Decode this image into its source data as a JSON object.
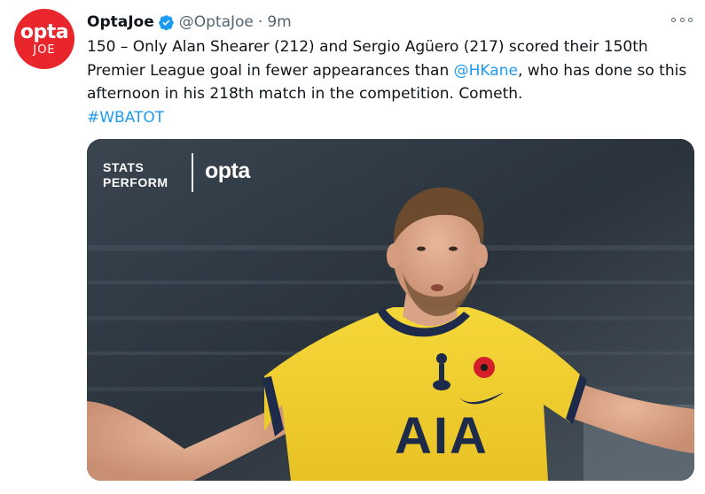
{
  "author": {
    "avatar_line1": "opta",
    "avatar_line2": "JOE",
    "name": "OptaJoe",
    "handle": "@OptaJoe",
    "separator": "·",
    "time": "9m"
  },
  "tweet": {
    "text_part1": "150 – Only Alan Shearer (212) and Sergio Agüero (217) scored their 150th Premier League goal in fewer appearances than ",
    "mention": "@HKane",
    "text_part2": ", who has done so this afternoon in his 218th match in the competition. Cometh.",
    "hashtag": "#WBATOT"
  },
  "media": {
    "logo_stats": "STATS",
    "logo_perform": "PERFORM",
    "logo_opta": "opta",
    "shirt_sponsor": "AIA"
  },
  "colors": {
    "brand_red": "#e8262c",
    "link_blue": "#1d9bf0",
    "shirt_yellow": "#f2d02e",
    "shirt_navy": "#1e2a4a"
  },
  "icons": [
    "verified-badge-icon",
    "more-options-icon",
    "poppy-icon",
    "club-crest-icon"
  ]
}
